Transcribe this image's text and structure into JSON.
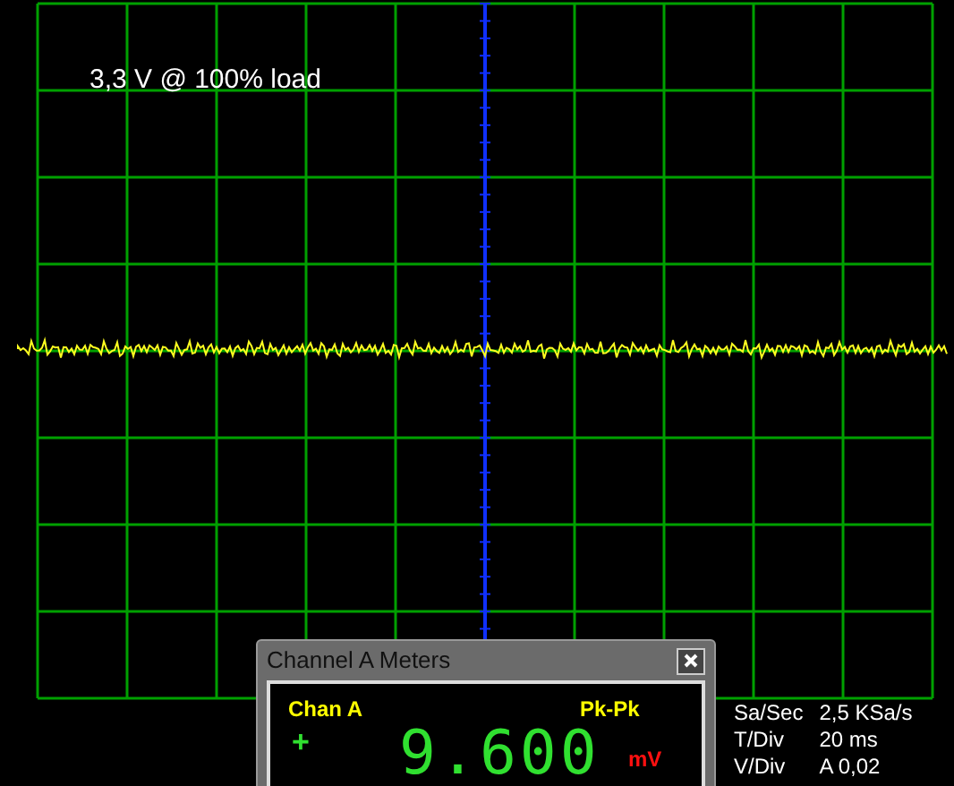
{
  "label": "3,3 V @ 100% load",
  "meter_window": {
    "title": "Channel A Meters",
    "channel": "Chan A",
    "measurement": "Pk-Pk",
    "sign": "+",
    "reading": "9.600",
    "unit": "mV"
  },
  "settings": [
    {
      "label": "Sa/Sec",
      "value": "2,5 KSa/s"
    },
    {
      "label": "T/Div",
      "value": "20 ms"
    },
    {
      "label": "V/Div",
      "value": "A 0,02"
    }
  ]
}
